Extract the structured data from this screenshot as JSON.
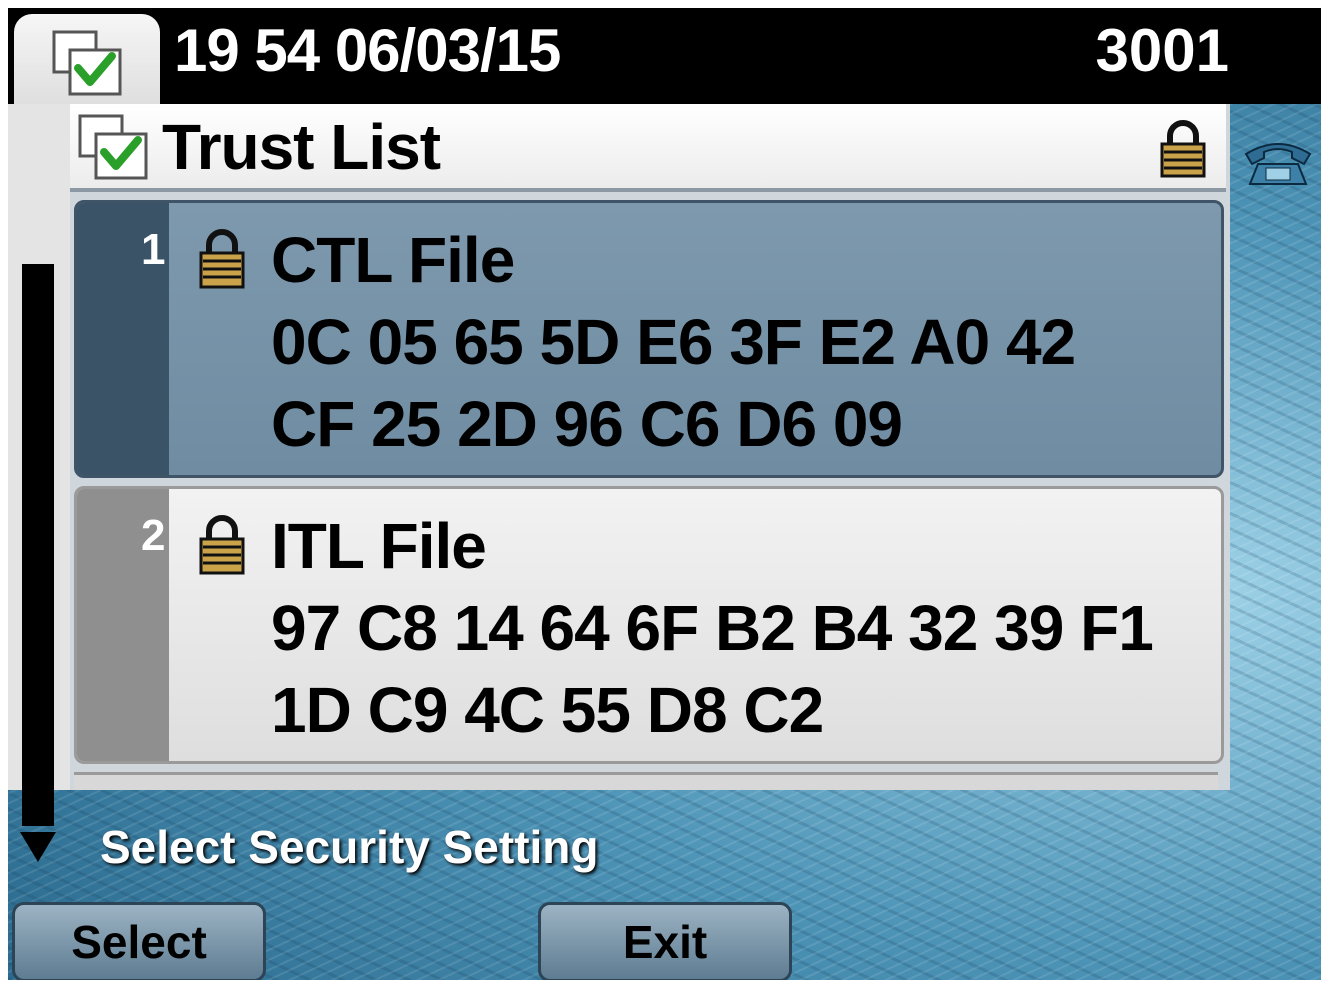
{
  "header": {
    "datetime": "19 54 06/03/15",
    "line_number": "3001"
  },
  "panel": {
    "title": "Trust List",
    "items": [
      {
        "index": "1",
        "name": "CTL File",
        "hash_line_1": "0C 05 65 5D E6 3F E2 A0 42",
        "hash_line_2": "CF 25 2D 96 C6 D6 09",
        "selected": true
      },
      {
        "index": "2",
        "name": "ITL File",
        "hash_line_1": "97 C8 14 64 6F B2 B4 32 39 F1",
        "hash_line_2": "1D C9 4C 55 D8 C2",
        "selected": false
      }
    ]
  },
  "prompt": "Select Security Setting",
  "softkeys": {
    "select_label": "Select",
    "exit_label": "Exit"
  },
  "icons": {
    "settings": "settings-check-icon",
    "lock": "padlock-icon",
    "phone": "phone-line-icon",
    "scroll": "scroll-down-arrow-icon"
  },
  "colors": {
    "selected_row": "#6f8ca2",
    "unselected_row": "#e8e8e8",
    "header_bg": "#000000",
    "softkey": "#7a96aa"
  }
}
